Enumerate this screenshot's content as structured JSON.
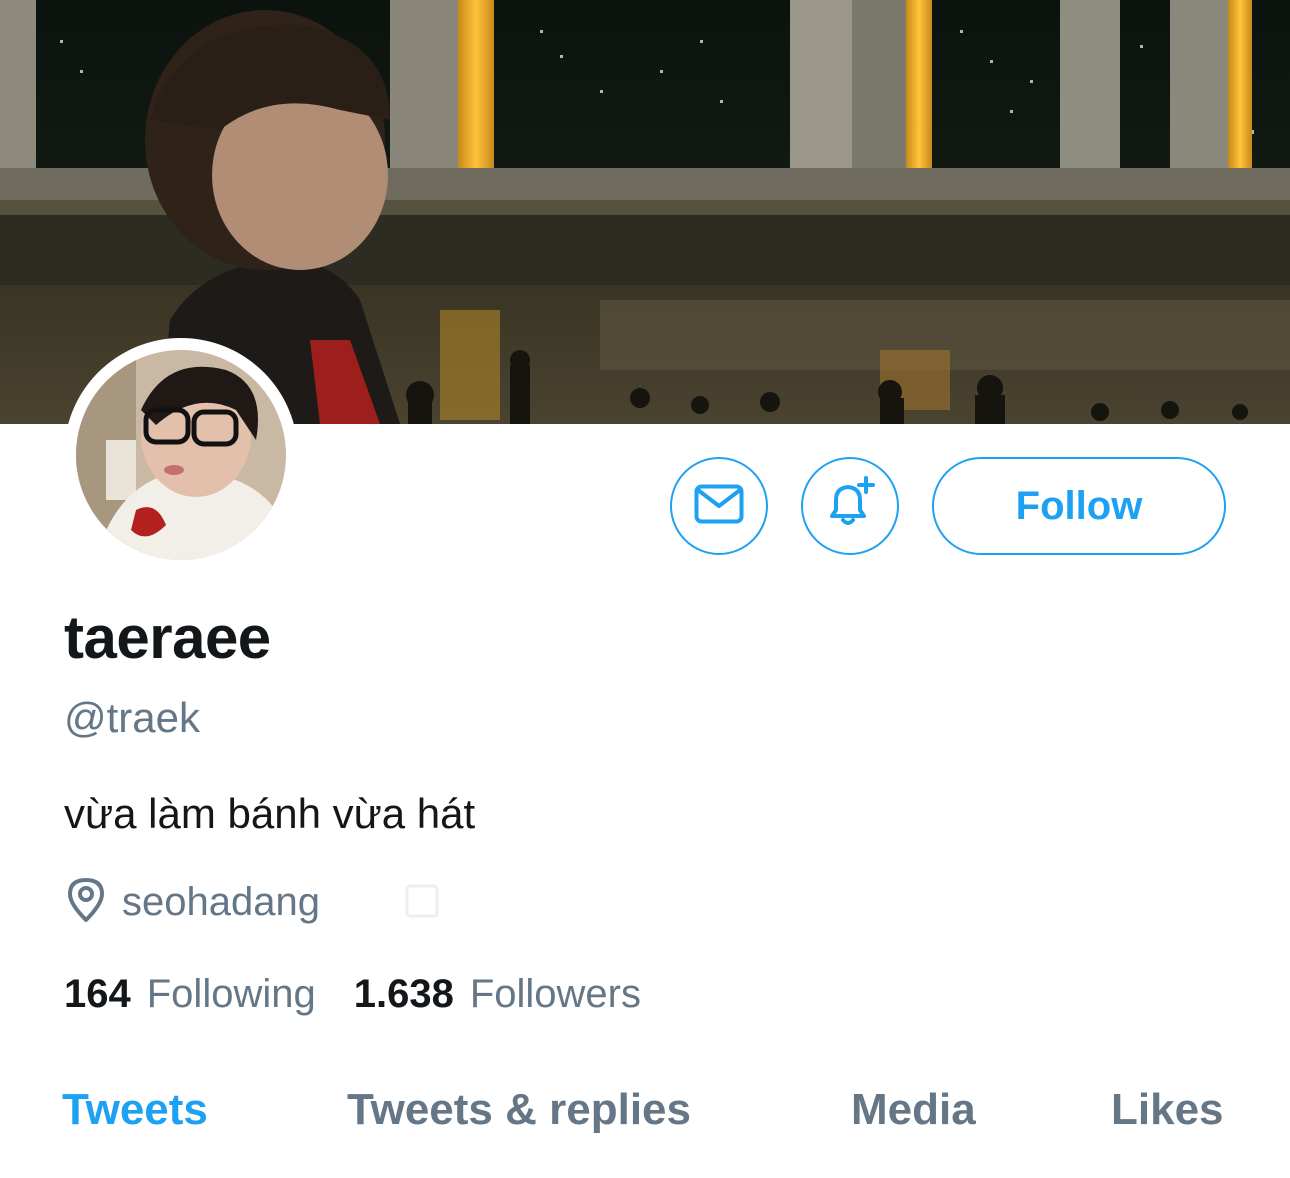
{
  "profile": {
    "display_name": "taeraee",
    "handle": "@traek",
    "bio": "vừa làm bánh vừa hát",
    "location": "seohadang",
    "following_count": "164",
    "following_label": "Following",
    "followers_count": "1.638",
    "followers_label": "Followers"
  },
  "actions": {
    "follow_label": "Follow"
  },
  "tabs": [
    {
      "label": "Tweets",
      "active": true
    },
    {
      "label": "Tweets & replies",
      "active": false
    },
    {
      "label": "Media",
      "active": false
    },
    {
      "label": "Likes",
      "active": false
    }
  ],
  "colors": {
    "accent": "#1da1f2",
    "text": "#14171a",
    "muted": "#657786"
  },
  "icons": [
    "mail-icon",
    "bell-plus-icon",
    "location-pin-icon",
    "calendar-icon"
  ]
}
